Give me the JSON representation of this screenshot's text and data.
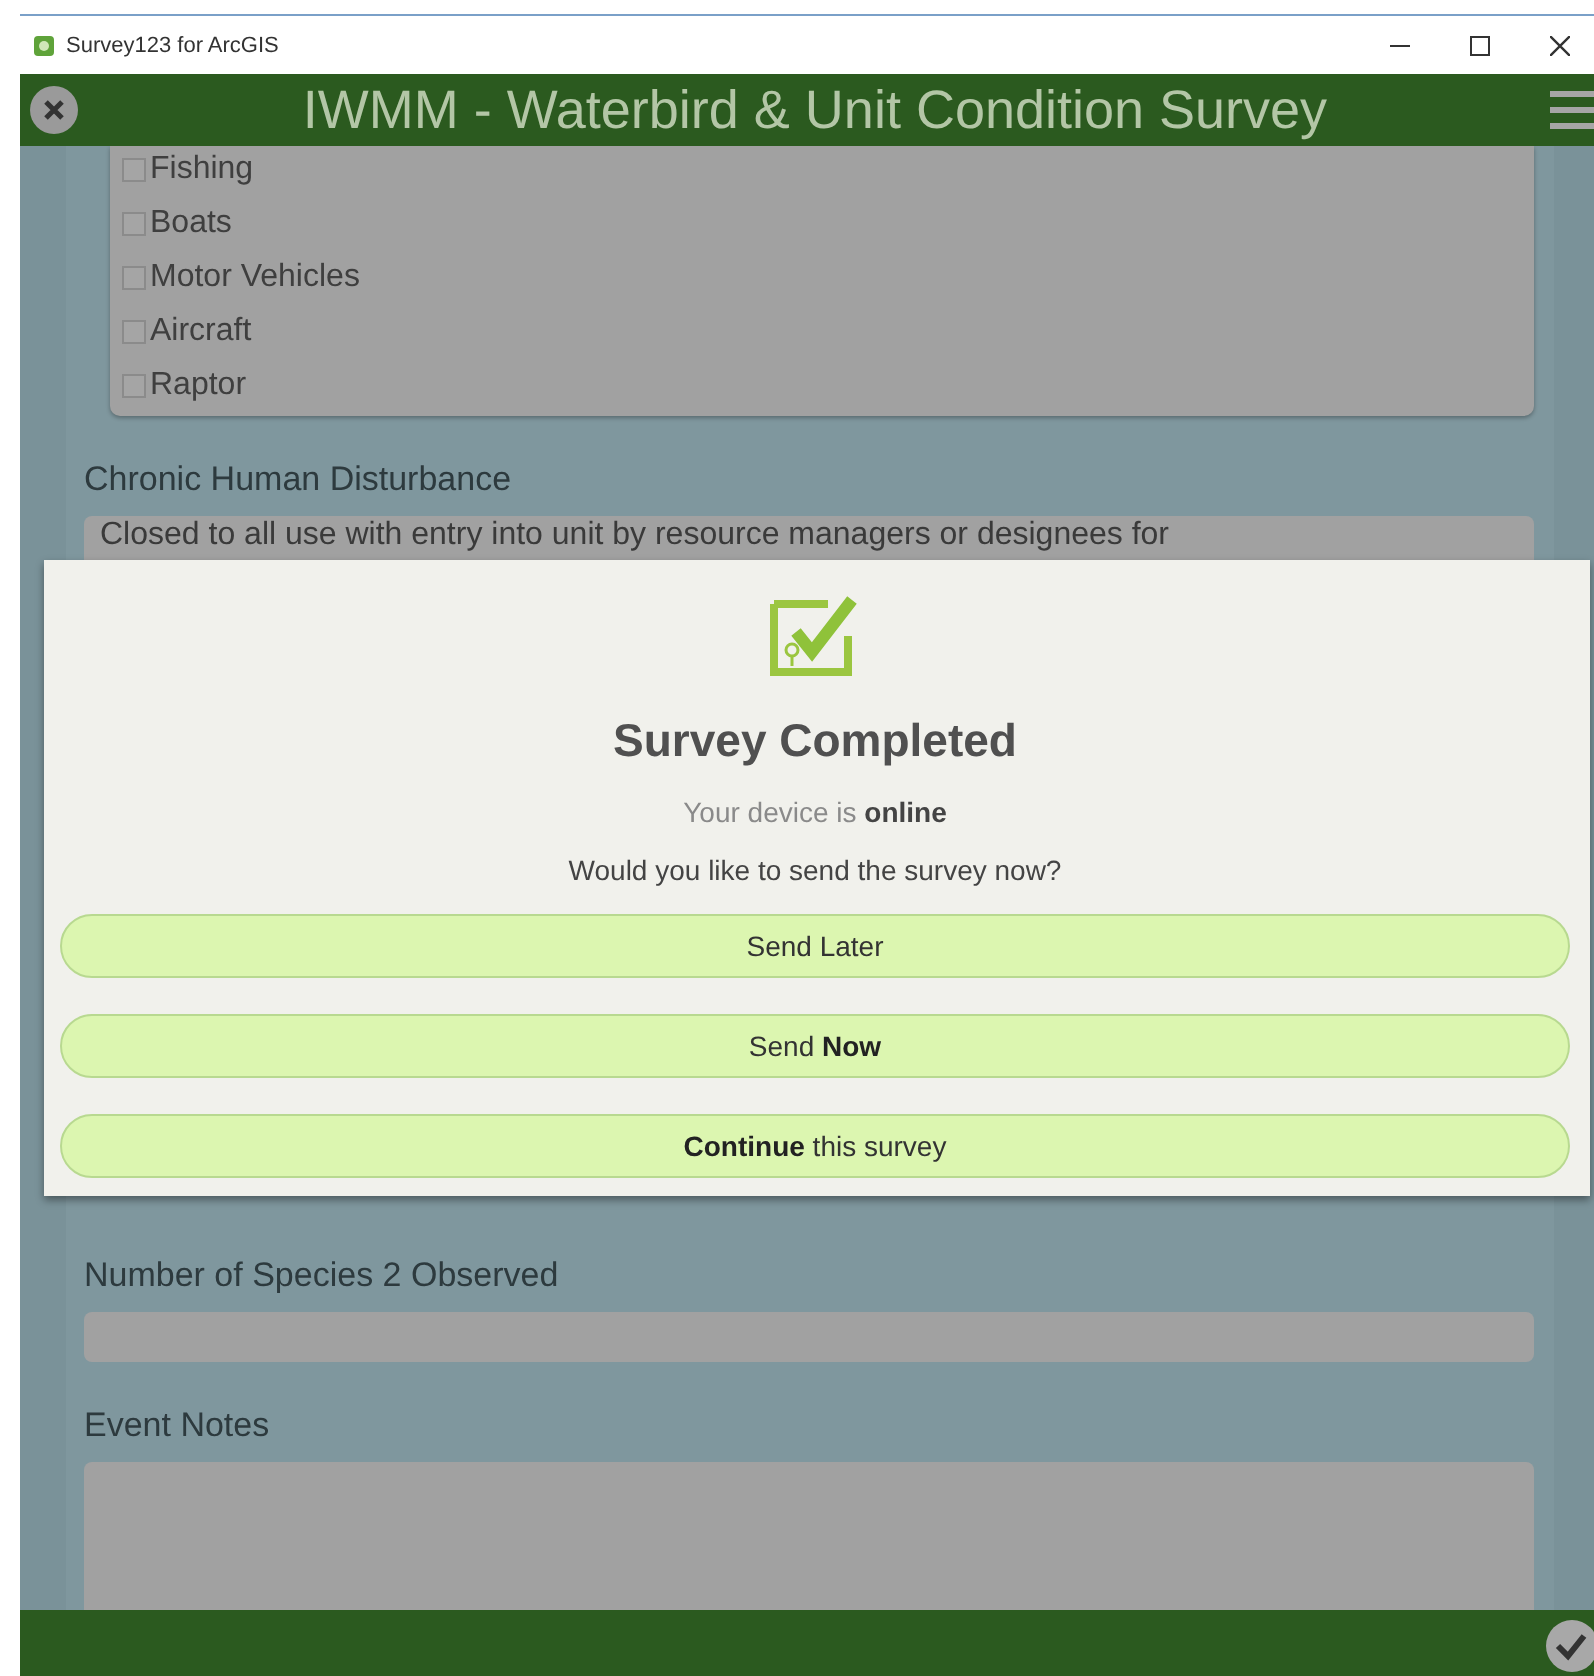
{
  "window": {
    "title": "Survey123 for ArcGIS"
  },
  "header": {
    "title": "IWMM - Waterbird & Unit Condition Survey"
  },
  "form": {
    "disturbance_options": [
      {
        "label": "Fishing",
        "checked": false
      },
      {
        "label": "Boats",
        "checked": false
      },
      {
        "label": "Motor Vehicles",
        "checked": false
      },
      {
        "label": "Aircraft",
        "checked": false
      },
      {
        "label": "Raptor",
        "checked": false
      }
    ],
    "chronic_disturbance": {
      "label": "Chronic Human Disturbance",
      "value": "Closed to all use with entry into unit by resource managers or designees for"
    },
    "species_2_count": {
      "label": "Number of Species 2 Observed"
    },
    "event_notes": {
      "label": "Event Notes"
    }
  },
  "dialog": {
    "title": "Survey Completed",
    "status": "Your device is **online**",
    "question": "Would you like to send the survey now?",
    "buttons": [
      "Send Later",
      "Send **Now**",
      "**Continue** this survey"
    ]
  }
}
